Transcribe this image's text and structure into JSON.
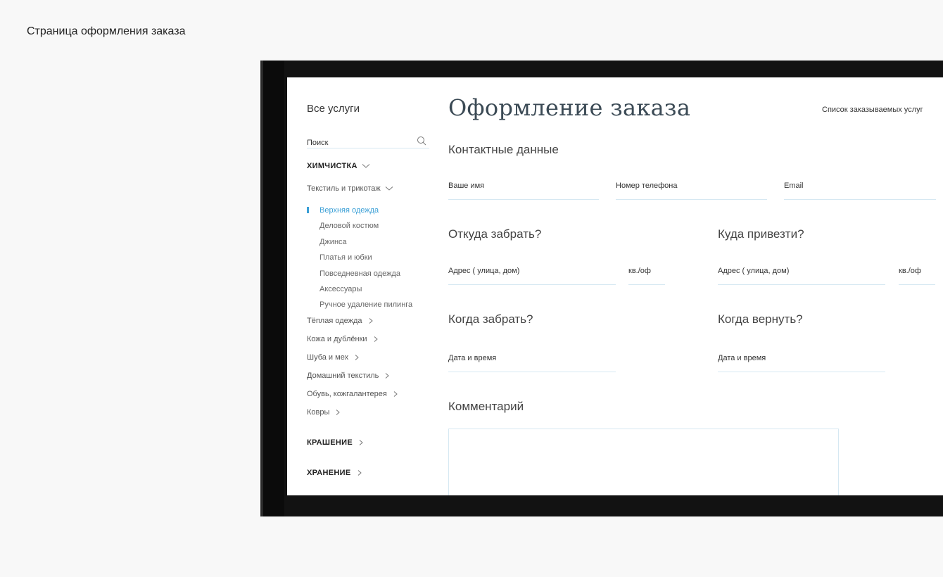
{
  "caption": "Страница оформления заказа",
  "sidebar": {
    "title": "Все услуги",
    "search_placeholder": "Поиск",
    "categories": [
      {
        "label": "ХИМЧИСТКА",
        "chevron": "down"
      },
      {
        "label": "КРАШЕНИЕ",
        "chevron": "right"
      },
      {
        "label": "ХРАНЕНИЕ",
        "chevron": "right"
      }
    ],
    "subcategories": [
      {
        "label": "Текстиль и трикотаж",
        "chevron": "down"
      },
      {
        "label": "Тёплая одежда",
        "chevron": "right"
      },
      {
        "label": "Кожа и дублёнки",
        "chevron": "right"
      },
      {
        "label": "Шуба и мех",
        "chevron": "right"
      },
      {
        "label": "Домашний текстиль",
        "chevron": "right"
      },
      {
        "label": "Обувь, кожгалантерея",
        "chevron": "right"
      },
      {
        "label": "Ковры",
        "chevron": "right"
      }
    ],
    "items": [
      {
        "label": "Верхняя одежда",
        "active": true
      },
      {
        "label": "Деловой костюм"
      },
      {
        "label": "Джинса"
      },
      {
        "label": "Платья и юбки"
      },
      {
        "label": "Повседневная одежда"
      },
      {
        "label": "Аксессуары"
      },
      {
        "label": "Ручное удаление пилинга"
      }
    ]
  },
  "main": {
    "title": "Оформление заказа",
    "services_link": "Список заказываемых услуг",
    "contact": {
      "heading": "Контактные данные",
      "name_placeholder": "Ваше имя",
      "phone_placeholder": "Номер телефона",
      "email_placeholder": "Email"
    },
    "pickup": {
      "heading": "Откуда забрать?",
      "address_placeholder": "Адрес ( улица, дом)",
      "apt_placeholder": "кв./оф"
    },
    "delivery": {
      "heading": "Куда привезти?",
      "address_placeholder": "Адрес ( улица, дом)",
      "apt_placeholder": "кв./оф"
    },
    "pickup_time": {
      "heading": "Когда забрать?",
      "datetime_placeholder": "Дата и время"
    },
    "return_time": {
      "heading": "Когда вернуть?",
      "datetime_placeholder": "Дата и время"
    },
    "comment": {
      "heading": "Комментарий"
    }
  },
  "colors": {
    "accent": "#3a9fd6",
    "title": "#3b4a55",
    "field_line": "#d6e8f2"
  }
}
